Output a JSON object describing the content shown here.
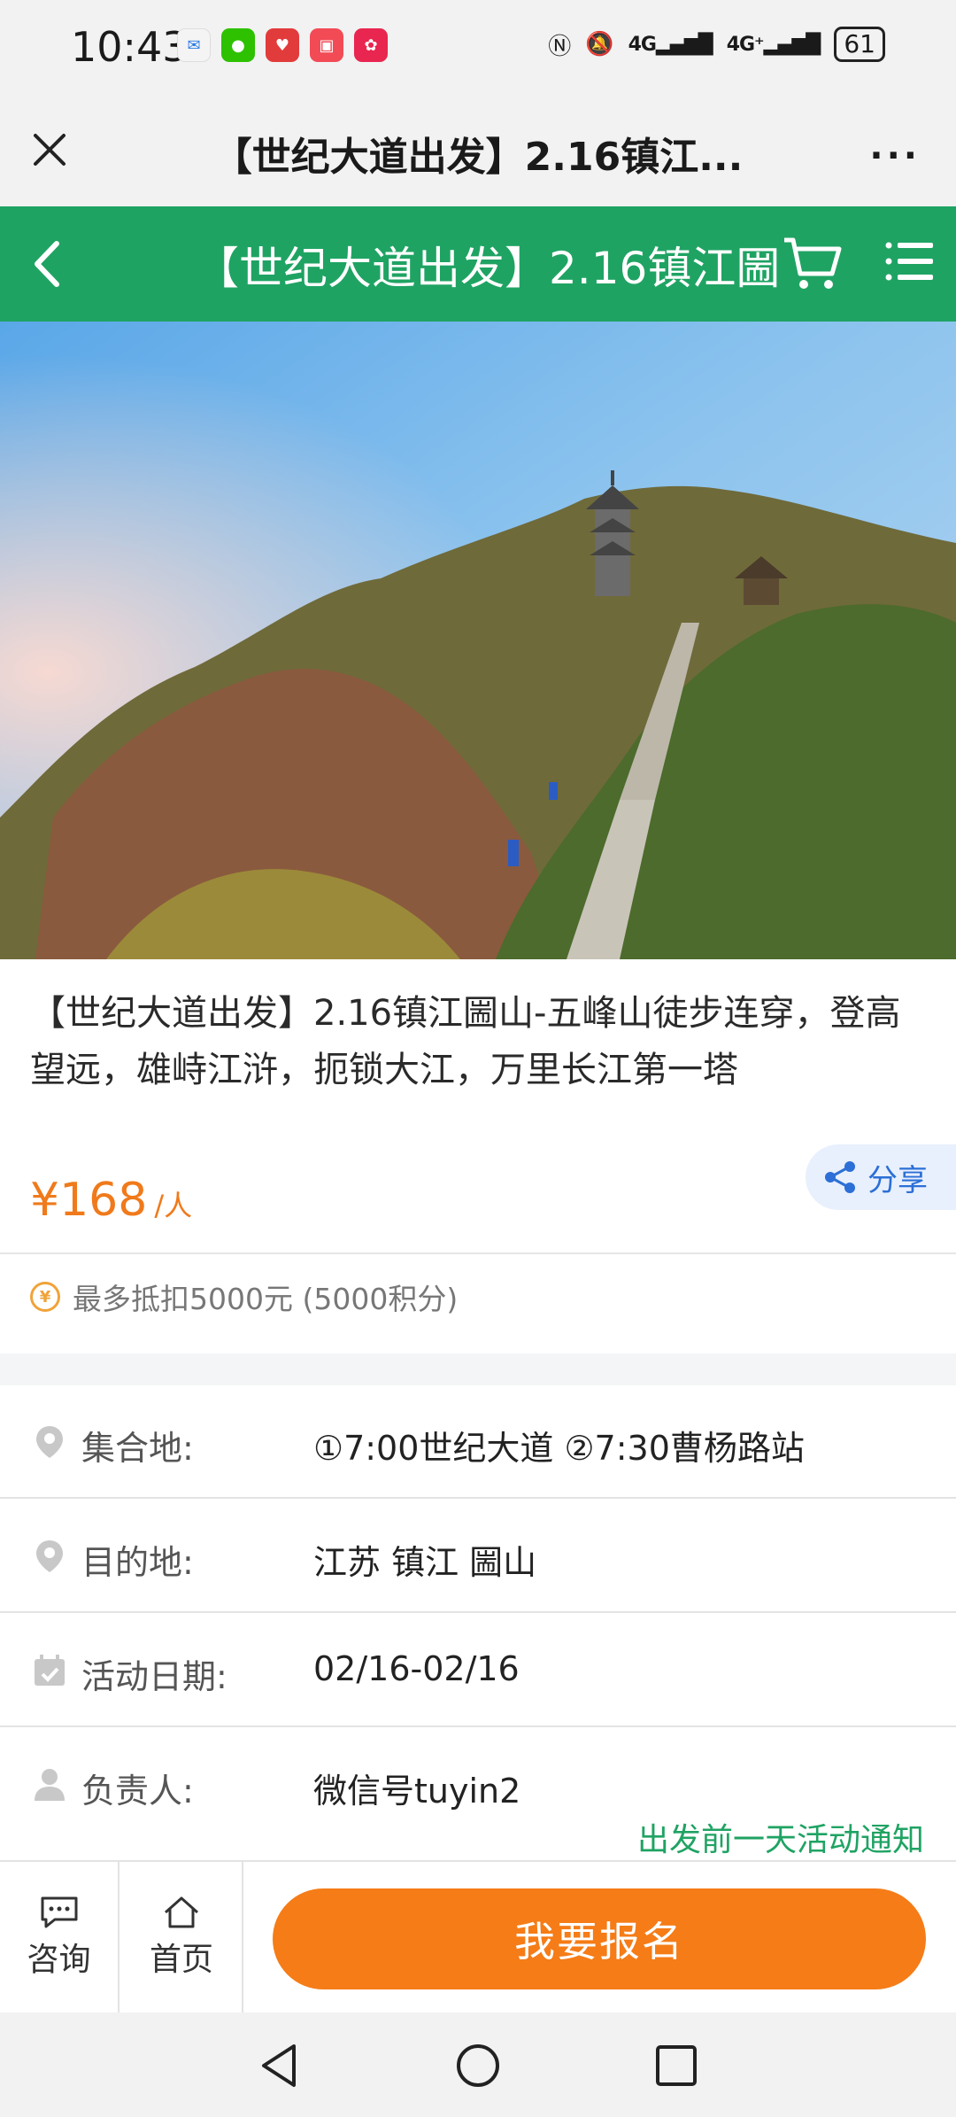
{
  "status_bar": {
    "time": "10:43",
    "network_1": "4G",
    "network_2": "4G⁺",
    "battery": "61"
  },
  "browser_bar": {
    "title": "【世纪大道出发】2.16镇江...",
    "more": "···"
  },
  "header": {
    "title": "【世纪大道出发】2.16镇江圌",
    "color": "#1fa363"
  },
  "product": {
    "title": "【世纪大道出发】2.16镇江圌山-五峰山徒步连穿，登高望远，雄峙江浒，扼锁大江，万里长江第一塔",
    "price": "¥168",
    "price_unit": "/人",
    "price_color": "#f07a1b",
    "share_label": "分享",
    "points_note": "最多抵扣5000元 (5000积分)"
  },
  "info_rows": [
    {
      "icon": "location-pin-icon",
      "label": "集合地:",
      "value": "①7:00世纪大道 ②7:30曹杨路站"
    },
    {
      "icon": "location-pin-icon",
      "label": "目的地:",
      "value": "江苏 镇江 圌山"
    },
    {
      "icon": "calendar-icon",
      "label": "活动日期:",
      "value": "02/16-02/16"
    },
    {
      "icon": "person-icon",
      "label": "负责人:",
      "value": "微信号tuyin2"
    }
  ],
  "notice": "出发前一天活动通知",
  "action_bar": {
    "consult_label": "咨询",
    "home_label": "首页",
    "signup_label": "我要报名",
    "signup_color": "#f57c17"
  }
}
